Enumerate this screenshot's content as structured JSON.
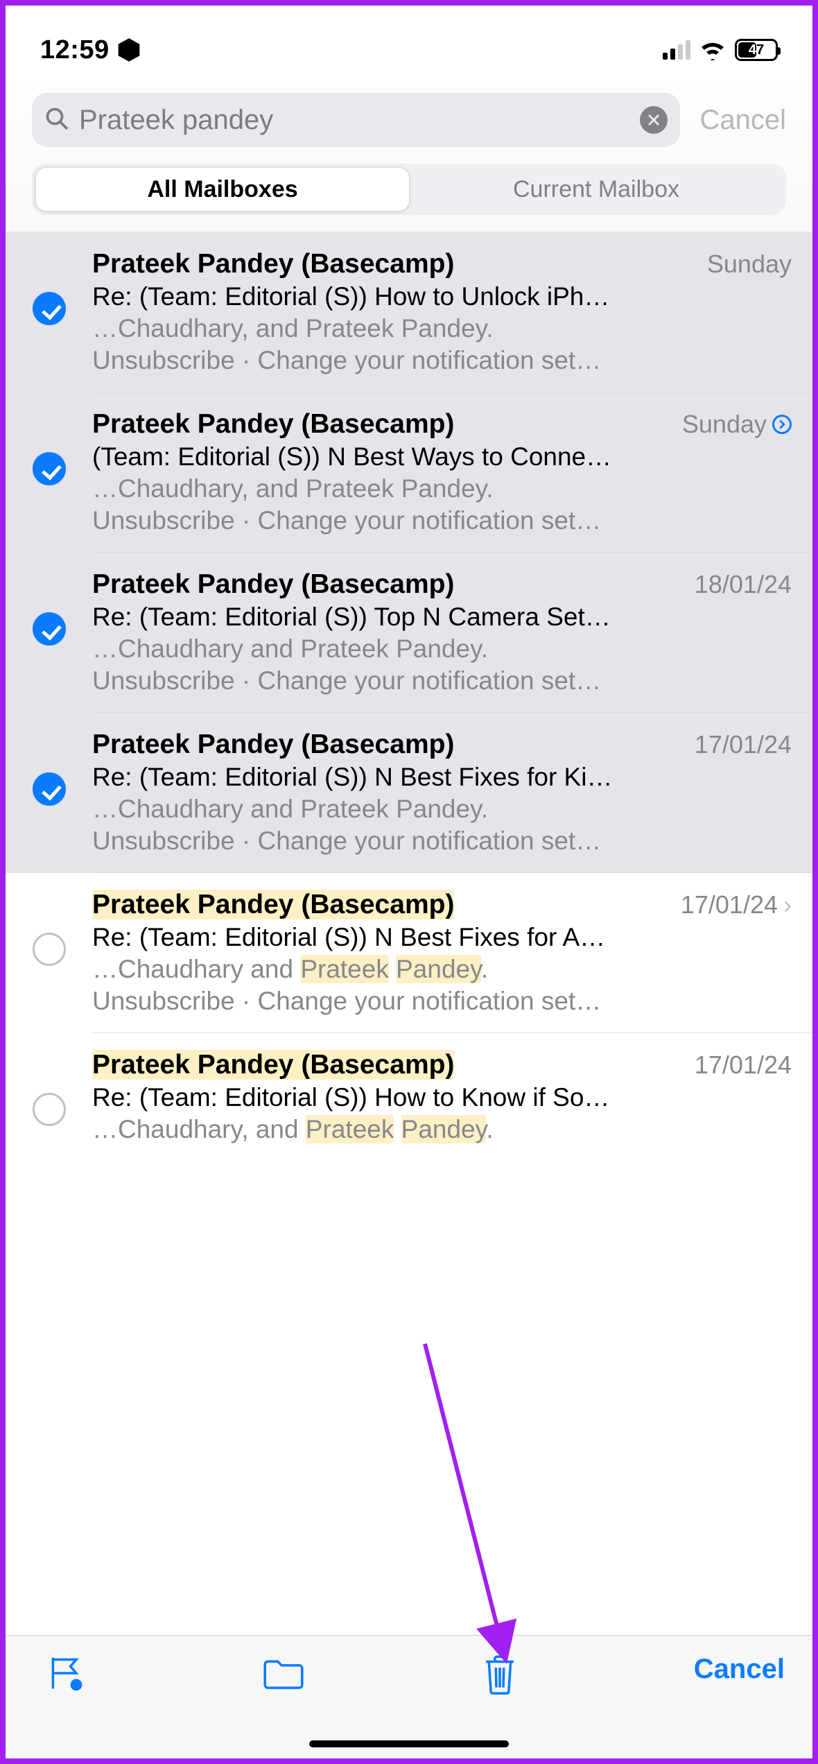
{
  "status_bar": {
    "time": "12:59",
    "battery_pct": "47"
  },
  "search": {
    "query": "Prateek pandey",
    "cancel_label": "Cancel",
    "scope_all": "All Mailboxes",
    "scope_current": "Current Mailbox"
  },
  "emails": [
    {
      "sender": "Prateek Pandey (Basecamp)",
      "date": "Sunday",
      "subject": "Re: (Team: Editorial (S)) How to Unlock iPh…",
      "preview1": "…Chaudhary, and Prateek Pandey.",
      "preview2": "Unsubscribe · Change your notification set…"
    },
    {
      "sender": "Prateek Pandey (Basecamp)",
      "date": "Sunday",
      "subject": "(Team: Editorial (S)) N Best Ways to Conne…",
      "preview1": "…Chaudhary, and Prateek Pandey.",
      "preview2": "Unsubscribe · Change your notification set…"
    },
    {
      "sender": "Prateek Pandey (Basecamp)",
      "date": "18/01/24",
      "subject": "Re: (Team: Editorial (S)) Top N Camera Set…",
      "preview1": "…Chaudhary and Prateek Pandey.",
      "preview2": "Unsubscribe · Change your notification set…"
    },
    {
      "sender": "Prateek Pandey (Basecamp)",
      "date": "17/01/24",
      "subject": "Re: (Team: Editorial (S)) N Best Fixes for Ki…",
      "preview1": "…Chaudhary and Prateek Pandey.",
      "preview2": "Unsubscribe · Change your notification set…"
    },
    {
      "sender_pre": "Prateek Pandey (Basecamp)",
      "date": "17/01/24",
      "subject": "Re: (Team: Editorial (S)) N Best Fixes for A…",
      "preview1_a": "…Chaudhary and ",
      "preview1_b": "Prateek",
      "preview1_c": " ",
      "preview1_d": "Pandey",
      "preview1_e": ".",
      "preview2": "Unsubscribe · Change your notification set…"
    },
    {
      "sender_pre": "Prateek Pandey (Basecamp)",
      "date": "17/01/24",
      "subject": "Re: (Team: Editorial (S)) How to Know if So…",
      "preview1_a": "…Chaudhary, and ",
      "preview1_b": "Prateek",
      "preview1_c": " ",
      "preview1_d": "Pandey",
      "preview1_e": "."
    }
  ],
  "toolbar": {
    "cancel": "Cancel"
  }
}
